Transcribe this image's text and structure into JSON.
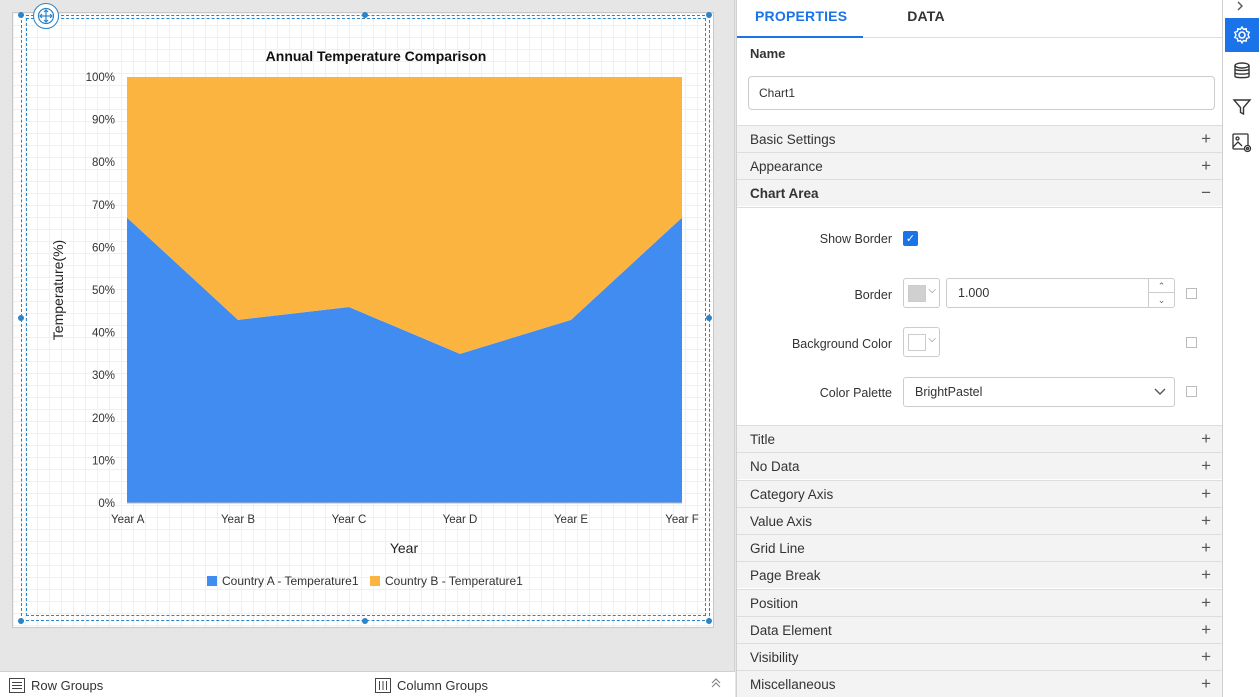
{
  "chart_data": {
    "type": "area",
    "stacking": "100%",
    "title": "Annual Temperature Comparison",
    "xlabel": "Year",
    "ylabel": "Temperature(%)",
    "categories": [
      "Year A",
      "Year B",
      "Year C",
      "Year D",
      "Year E",
      "Year F"
    ],
    "ylim": [
      0,
      100
    ],
    "yticks": [
      "0%",
      "10%",
      "20%",
      "30%",
      "40%",
      "50%",
      "60%",
      "70%",
      "80%",
      "90%",
      "100%"
    ],
    "series": [
      {
        "name": "Country A - Temperature1",
        "values": [
          67,
          43,
          46,
          35,
          43,
          67
        ],
        "color": "#418cf0"
      },
      {
        "name": "Country B - Temperature1",
        "values": [
          33,
          57,
          54,
          65,
          57,
          33
        ],
        "color": "#fcb441"
      }
    ],
    "grid": false,
    "legend_position": "bottom"
  },
  "bottom_bar": {
    "row_groups": "Row Groups",
    "column_groups": "Column Groups"
  },
  "panel": {
    "tabs": [
      "PROPERTIES",
      "DATA"
    ],
    "name_label": "Name",
    "name_value": "Chart1",
    "sections_top": [
      "Basic Settings",
      "Appearance",
      "Chart Area"
    ],
    "chart_area": {
      "show_border_label": "Show Border",
      "border_label": "Border",
      "border_value": "1.000",
      "background_color_label": "Background Color",
      "color_palette_label": "Color Palette",
      "color_palette_value": "BrightPastel",
      "border_color": "#d0d0d0",
      "background_color": "#ffffff"
    },
    "sections_bottom": [
      "Title",
      "No Data",
      "Category Axis",
      "Value Axis",
      "Grid Line",
      "Page Break",
      "Position",
      "Data Element",
      "Visibility",
      "Miscellaneous"
    ]
  },
  "icons": {
    "strip": [
      "gear-icon",
      "database-icon",
      "filter-icon",
      "image-settings-icon"
    ],
    "accent": "#1a73e8"
  }
}
